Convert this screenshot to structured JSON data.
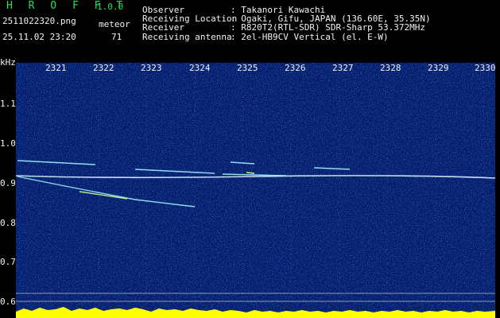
{
  "app": {
    "title": "H R O F F T",
    "version": "1.0.0"
  },
  "file": {
    "name": "2511022320.png",
    "datetime": "25.11.02 23:20"
  },
  "meteor": {
    "label": "meteor",
    "count": "71"
  },
  "info": [
    {
      "key": "Observer",
      "value": ": Takanori Kawachi"
    },
    {
      "key": "Receiving Location",
      "value": ": Ogaki, Gifu, JAPAN (136.60E, 35.35N)"
    },
    {
      "key": "Receiver",
      "value": ": R820T2(RTL-SDR) SDR-Sharp 53.372MHz"
    },
    {
      "key": "Receiving antenna",
      "value": ": 2el-HB9CV Vertical (el. E-W)"
    }
  ],
  "axis": {
    "y_unit": "kHz",
    "y_ticks": [
      "1.1",
      "1.0",
      "0.9",
      "0.8",
      "0.7",
      "0.6"
    ],
    "x_ticks": [
      "2321",
      "2322",
      "2323",
      "2324",
      "2325",
      "2326",
      "2327",
      "2328",
      "2329",
      "2330"
    ]
  },
  "colors": {
    "header_green": "#22e05a",
    "background": "#061a6a",
    "signal": "#e8ffff",
    "trace": "#ffff00"
  }
}
